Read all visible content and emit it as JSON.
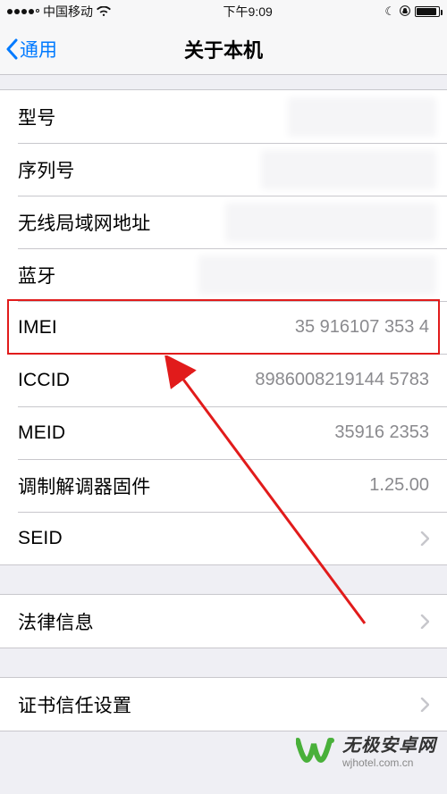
{
  "statusbar": {
    "carrier": "中国移动",
    "time": "下午9:09"
  },
  "nav": {
    "back_label": "通用",
    "title": "关于本机"
  },
  "rows": {
    "model": {
      "label": "型号",
      "value": ""
    },
    "serial": {
      "label": "序列号",
      "value": ""
    },
    "wifi_addr": {
      "label": "无线局域网地址",
      "value": ""
    },
    "bluetooth": {
      "label": "蓝牙",
      "value": ""
    },
    "imei": {
      "label": "IMEI",
      "value": "35 916107        353 4"
    },
    "iccid": {
      "label": "ICCID",
      "value": "8986008219144      5783"
    },
    "meid": {
      "label": "MEID",
      "value": "35916        2353"
    },
    "modem": {
      "label": "调制解调器固件",
      "value": "1.25.00"
    },
    "seid": {
      "label": "SEID",
      "value": ""
    },
    "legal": {
      "label": "法律信息",
      "value": ""
    },
    "cert": {
      "label": "证书信任设置",
      "value": ""
    }
  },
  "watermark": {
    "main": "无极安卓网",
    "sub": "wjhotel.com.cn"
  }
}
